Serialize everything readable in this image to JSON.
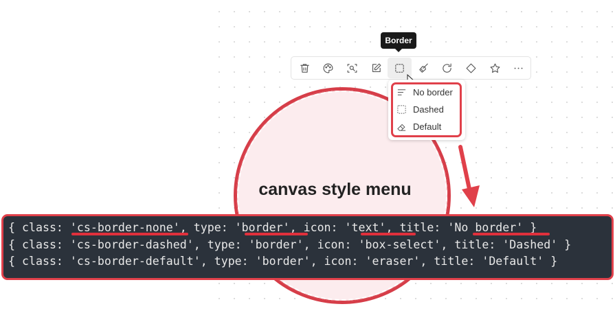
{
  "canvas": {
    "title": "canvas style menu"
  },
  "tooltip": "Border",
  "toolbar": {
    "buttons": [
      "trash-icon",
      "palette-icon",
      "scan-search-icon",
      "edit-icon",
      "box-select-icon",
      "brush-icon",
      "rotate-icon",
      "diamond-icon",
      "star-icon",
      "more-icon"
    ],
    "active": "box-select-icon"
  },
  "menu": {
    "items": [
      {
        "label": "No border",
        "icon": "text-icon"
      },
      {
        "label": "Dashed",
        "icon": "box-select-icon"
      },
      {
        "label": "Default",
        "icon": "eraser-icon"
      }
    ]
  },
  "code": {
    "lines": [
      "{ class: 'cs-border-none', type: 'border', icon: 'text', title: 'No border' }",
      "{ class: 'cs-border-dashed', type: 'border', icon: 'box-select', title: 'Dashed' }",
      "{ class: 'cs-border-default', type: 'border', icon: 'eraser', title: 'Default' }"
    ]
  },
  "colors": {
    "highlight": "#e0404a",
    "code_bg": "#2b323b",
    "shape_fill": "#fcecee"
  }
}
